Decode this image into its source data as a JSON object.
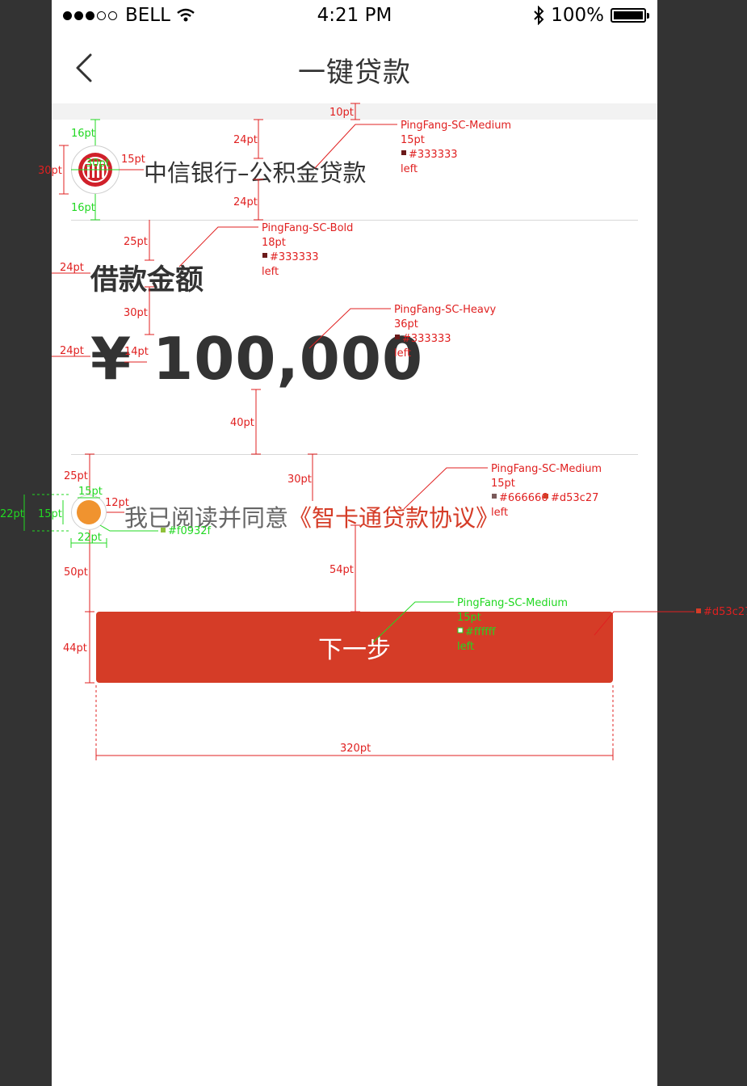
{
  "status_bar": {
    "carrier": "BELL",
    "time": "4:21 PM",
    "battery": "100%"
  },
  "nav": {
    "title": "一键贷款"
  },
  "bank": {
    "name": "中信银行–公积金贷款"
  },
  "loan": {
    "label": "借款金额",
    "amount": "¥ 100,000"
  },
  "agreement": {
    "prefix": "我已阅读并同意",
    "link_text": "《智卡通贷款协议》",
    "checked": true
  },
  "next_button": {
    "label": "下一步"
  },
  "colors": {
    "text_primary": "#333333",
    "text_secondary": "#666666",
    "accent": "#d53c27",
    "checkbox": "#f0932f",
    "button_text": "#ffffff"
  },
  "annotations": {
    "spacing": [
      "10pt",
      "24pt",
      "24pt",
      "16pt",
      "16pt",
      "30pt",
      "30pt",
      "15pt",
      "25pt",
      "24pt",
      "30pt",
      "24pt",
      "14pt",
      "40pt",
      "25pt",
      "30pt",
      "22pt",
      "15pt",
      "15pt",
      "12pt",
      "22pt",
      "50pt",
      "54pt",
      "44pt",
      "320pt"
    ],
    "title_spec": {
      "font": "PingFang-SC-Medium",
      "size": "15pt",
      "color": "#333333",
      "align": "left"
    },
    "label_spec": {
      "font": "PingFang-SC-Bold",
      "size": "18pt",
      "color": "#333333",
      "align": "left"
    },
    "amount_spec": {
      "font": "PingFang-SC-Heavy",
      "size": "36pt",
      "color": "#333333",
      "align": "left"
    },
    "agree_spec": {
      "font": "PingFang-SC-Medium",
      "size": "15pt",
      "color": "#666666",
      "color2": "#d53c27",
      "align": "left"
    },
    "checkbox_color": "#f0932f",
    "button_spec": {
      "font": "PingFang-SC-Medium",
      "size": "15pt",
      "color": "#ffffff",
      "align": "left"
    },
    "button_color": "#d53c27"
  }
}
